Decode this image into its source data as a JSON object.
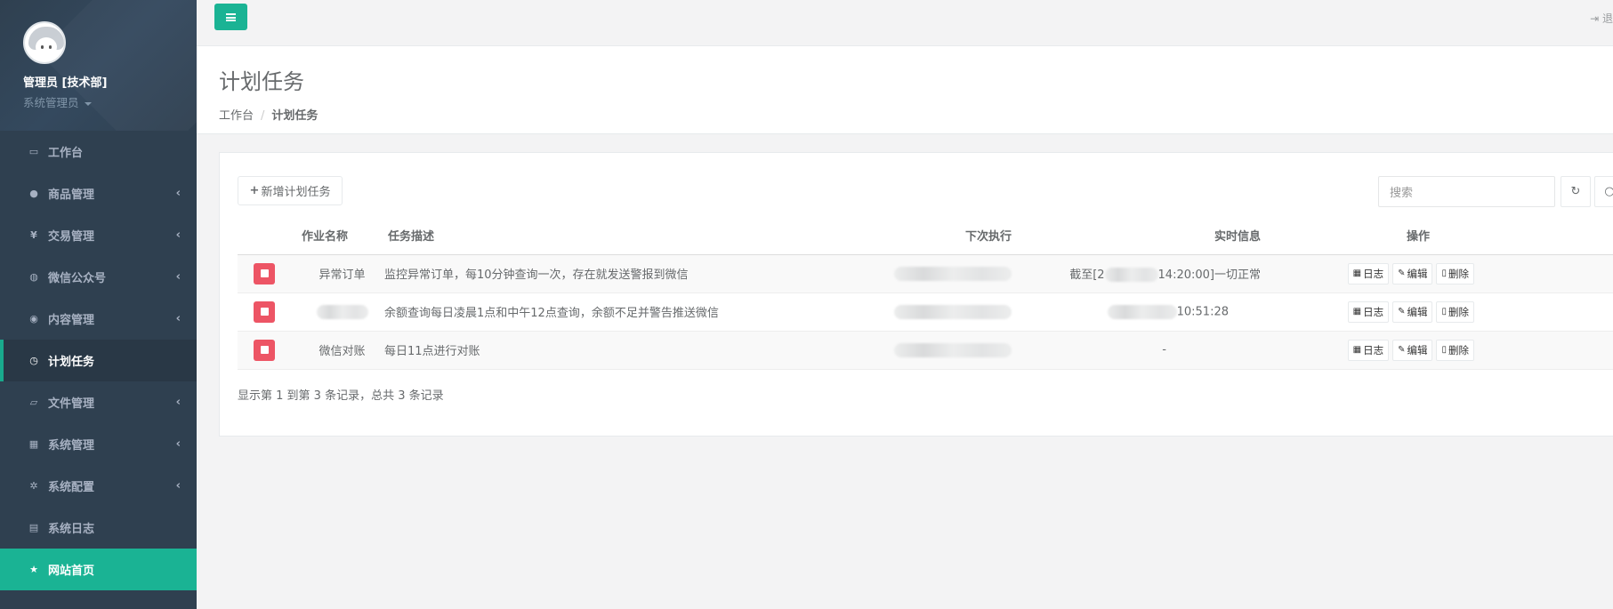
{
  "sidebar": {
    "user_name": "管理员 [技术部]",
    "user_role": "系统管理员",
    "items": [
      {
        "label": "工作台",
        "icon": "desktop-icon",
        "glyph": "▭",
        "has_arrow": false
      },
      {
        "label": "商品管理",
        "icon": "apple-icon",
        "glyph": "●",
        "has_arrow": true
      },
      {
        "label": "交易管理",
        "icon": "yen-icon",
        "glyph": "¥",
        "has_arrow": true
      },
      {
        "label": "微信公众号",
        "icon": "wechat-icon",
        "glyph": "◍",
        "has_arrow": true
      },
      {
        "label": "内容管理",
        "icon": "chrome-icon",
        "glyph": "◉",
        "has_arrow": true
      },
      {
        "label": "计划任务",
        "icon": "clock-icon",
        "glyph": "◷",
        "has_arrow": false
      },
      {
        "label": "文件管理",
        "icon": "folder-icon",
        "glyph": "▱",
        "has_arrow": true
      },
      {
        "label": "系统管理",
        "icon": "windows-icon",
        "glyph": "▦",
        "has_arrow": true
      },
      {
        "label": "系统配置",
        "icon": "gear-icon",
        "glyph": "✲",
        "has_arrow": true
      },
      {
        "label": "系统日志",
        "icon": "file-icon",
        "glyph": "▤",
        "has_arrow": false
      },
      {
        "label": "网站首页",
        "icon": "star-icon",
        "glyph": "★",
        "has_arrow": false
      }
    ]
  },
  "topbar": {
    "logout_label": "退"
  },
  "page": {
    "title": "计划任务",
    "breadcrumb": [
      "工作台",
      "计划任务"
    ]
  },
  "toolbar": {
    "add_label": "新增计划任务",
    "search_placeholder": "搜索"
  },
  "table": {
    "headers": [
      "作业名称",
      "任务描述",
      "下次执行",
      "实时信息",
      "操作"
    ],
    "rows": [
      {
        "name": "异常订单",
        "desc": "监控异常订单，每10分钟查询一次，存在就发送警报到微信",
        "realtime": "截至[2",
        "realtime_tail": "14:20:00]一切正常"
      },
      {
        "name": "",
        "desc": "余额查询每日凌晨1点和中午12点查询，余额不足并警告推送微信",
        "realtime": "",
        "realtime_tail": "10:51:28"
      },
      {
        "name": "微信对账",
        "desc": "每日11点进行对账",
        "realtime": "-",
        "realtime_tail": ""
      }
    ],
    "actions": {
      "log": "日志",
      "edit": "编辑",
      "delete": "删除"
    }
  },
  "footer": {
    "pagination_info": "显示第 1 到第 3 条记录，总共 3 条记录"
  },
  "colors": {
    "accent": "#1ab394",
    "sidebar_bg": "#2f4050",
    "danger": "#ed5565"
  }
}
